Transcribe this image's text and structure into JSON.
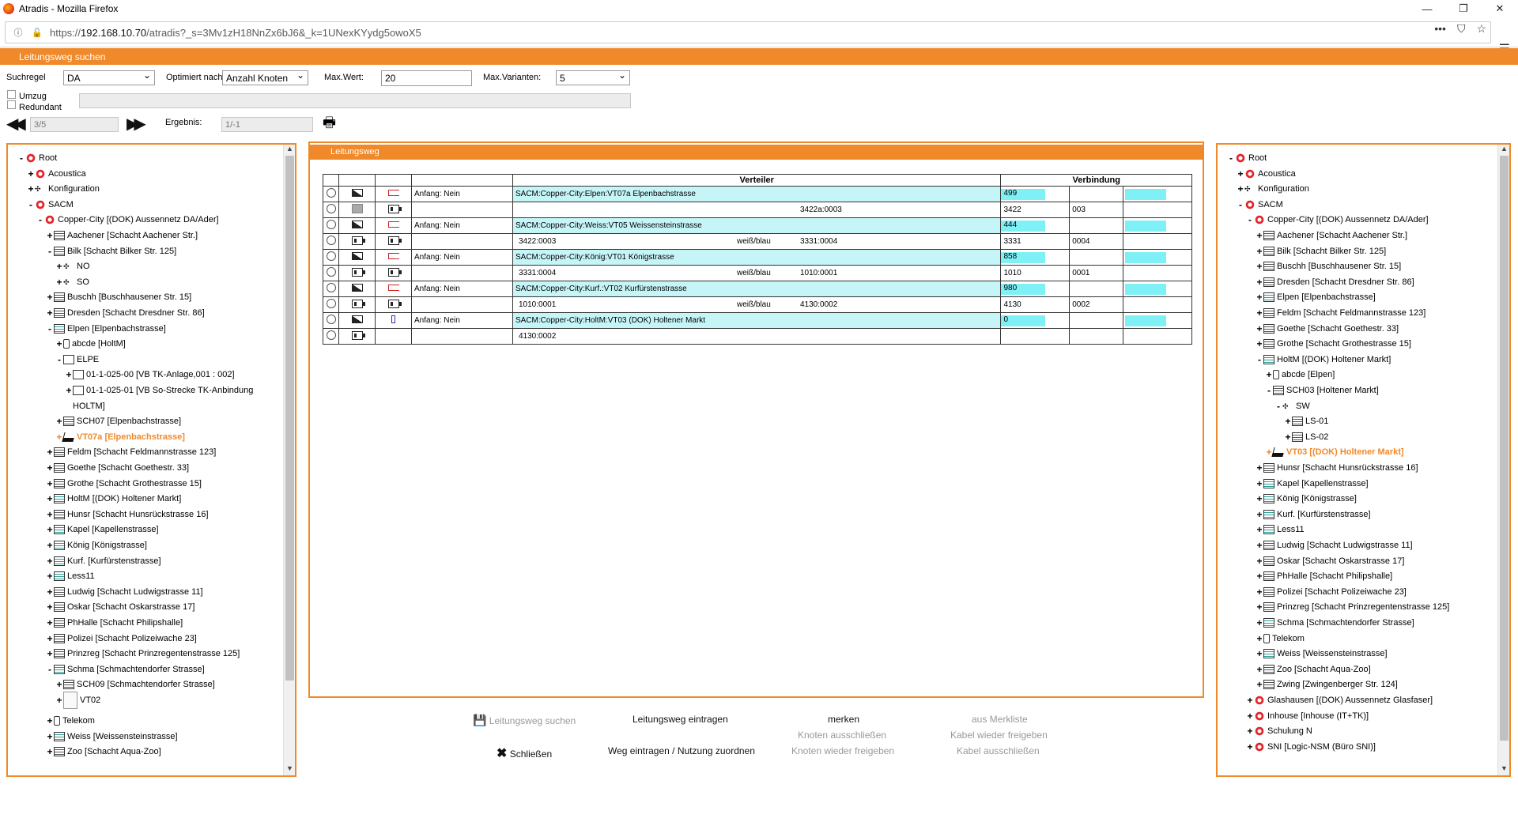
{
  "window": {
    "title": "Atradis - Mozilla Firefox"
  },
  "browser": {
    "url_prefix": "https://",
    "url_host": "192.168.10.70",
    "url_path": "/atradis?_s=3Mv1zH18NnZx6bJ6&_k=1UNexKYydg5owoX5"
  },
  "header": {
    "title": "Leitungsweg suchen"
  },
  "search": {
    "suchregel_label": "Suchregel",
    "suchregel_value": "DA",
    "optimiert_label": "Optimiert nach:",
    "optimiert_value": "Anzahl Knoten",
    "maxwert_label": "Max.Wert:",
    "maxwert_value": "20",
    "maxvar_label": "Max.Varianten:",
    "maxvar_value": "5",
    "umzug_label": "Umzug",
    "redundant_label": "Redundant",
    "page_value": "3/5",
    "ergebnis_label": "Ergebnis:",
    "ergebnis_value": "1/-1"
  },
  "left_tree": [
    {
      "t": "Root",
      "pm": "-",
      "ic": "sacm",
      "d": 0
    },
    {
      "t": "Acoustica",
      "pm": "+",
      "ic": "sacm",
      "d": 1
    },
    {
      "t": "Konfiguration",
      "pm": "+",
      "ic": "star",
      "d": 1
    },
    {
      "t": "SACM",
      "pm": "-",
      "ic": "sacm",
      "d": 1
    },
    {
      "t": "Copper-City [(DOK) Aussennetz DA/Ader]",
      "pm": "-",
      "ic": "sacm",
      "d": 2
    },
    {
      "t": "Aachener [Schacht Aachener Str.]",
      "pm": "+",
      "ic": "cab",
      "d": 3
    },
    {
      "t": "Bilk [Schacht Bilker Str. 125]",
      "pm": "-",
      "ic": "cab",
      "d": 3
    },
    {
      "t": "NO",
      "pm": "+",
      "ic": "star",
      "d": 4
    },
    {
      "t": "SO",
      "pm": "+",
      "ic": "star",
      "d": 4
    },
    {
      "t": "Buschh [Buschhausener Str. 15]",
      "pm": "+",
      "ic": "cab",
      "d": 3
    },
    {
      "t": "Dresden [Schacht Dresdner Str. 86]",
      "pm": "+",
      "ic": "cab",
      "d": 3
    },
    {
      "t": "Elpen [Elpenbachstrasse]",
      "pm": "-",
      "ic": "cabc",
      "d": 3
    },
    {
      "t": "abcde [HoltM]",
      "pm": "+",
      "ic": "phone",
      "d": 4
    },
    {
      "t": "ELPE",
      "pm": "-",
      "ic": "box",
      "d": 4
    },
    {
      "t": "01-1-025-00 [VB TK-Anlage,001 : 002]",
      "pm": "+",
      "ic": "box",
      "d": 5
    },
    {
      "t": "01-1-025-01 [VB So-Strecke TK-Anbindung",
      "pm": "+",
      "ic": "box",
      "d": 5
    },
    {
      "t": "HOLTM]",
      "pm": "",
      "ic": "",
      "d": 5
    },
    {
      "t": "SCH07 [Elpenbachstrasse]",
      "pm": "+",
      "ic": "cab",
      "d": 4
    },
    {
      "t": "VT07a [Elpenbachstrasse]",
      "pm": "+",
      "ic": "vt",
      "d": 4,
      "hl": true
    },
    {
      "t": "Feldm [Schacht Feldmannstrasse 123]",
      "pm": "+",
      "ic": "cab",
      "d": 3
    },
    {
      "t": "Goethe [Schacht Goethestr. 33]",
      "pm": "+",
      "ic": "cab",
      "d": 3
    },
    {
      "t": "Grothe [Schacht Grothestrasse 15]",
      "pm": "+",
      "ic": "cab",
      "d": 3
    },
    {
      "t": "HoltM [(DOK) Holtener Markt]",
      "pm": "+",
      "ic": "cabc",
      "d": 3
    },
    {
      "t": "Hunsr [Schacht Hunsrückstrasse 16]",
      "pm": "+",
      "ic": "cab",
      "d": 3
    },
    {
      "t": "Kapel [Kapellenstrasse]",
      "pm": "+",
      "ic": "cabc",
      "d": 3
    },
    {
      "t": "König [Königstrasse]",
      "pm": "+",
      "ic": "cabc",
      "d": 3
    },
    {
      "t": "Kurf. [Kurfürstenstrasse]",
      "pm": "+",
      "ic": "cabc",
      "d": 3
    },
    {
      "t": "Less11",
      "pm": "+",
      "ic": "cabc",
      "d": 3
    },
    {
      "t": "Ludwig [Schacht Ludwigstrasse 11]",
      "pm": "+",
      "ic": "cab",
      "d": 3
    },
    {
      "t": "Oskar [Schacht Oskarstrasse 17]",
      "pm": "+",
      "ic": "cab",
      "d": 3
    },
    {
      "t": "PhHalle [Schacht Philipshalle]",
      "pm": "+",
      "ic": "cab",
      "d": 3
    },
    {
      "t": "Polizei [Schacht Polizeiwache 23]",
      "pm": "+",
      "ic": "cab",
      "d": 3
    },
    {
      "t": "Prinzreg [Schacht Prinzregentenstrasse 125]",
      "pm": "+",
      "ic": "cab",
      "d": 3
    },
    {
      "t": "Schma [Schmachtendorfer Strasse]",
      "pm": "-",
      "ic": "cabc",
      "d": 3
    },
    {
      "t": "SCH09 [Schmachtendorfer Strasse]",
      "pm": "+",
      "ic": "cab",
      "d": 4
    },
    {
      "t": "VT02",
      "pm": "+",
      "ic": "doc",
      "d": 4
    },
    {
      "t": "Telekom",
      "pm": "+",
      "ic": "phone",
      "d": 3
    },
    {
      "t": "Weiss [Weissensteinstrasse]",
      "pm": "+",
      "ic": "cabc",
      "d": 3
    },
    {
      "t": "Zoo [Schacht Aqua-Zoo]",
      "pm": "+",
      "ic": "cab",
      "d": 3
    }
  ],
  "right_tree": [
    {
      "t": "Root",
      "pm": "-",
      "ic": "sacm",
      "d": 0
    },
    {
      "t": "Acoustica",
      "pm": "+",
      "ic": "sacm",
      "d": 1
    },
    {
      "t": "Konfiguration",
      "pm": "+",
      "ic": "star",
      "d": 1
    },
    {
      "t": "SACM",
      "pm": "-",
      "ic": "sacm",
      "d": 1
    },
    {
      "t": "Copper-City [(DOK) Aussennetz DA/Ader]",
      "pm": "-",
      "ic": "sacm",
      "d": 2
    },
    {
      "t": "Aachener [Schacht Aachener Str.]",
      "pm": "+",
      "ic": "cab",
      "d": 3
    },
    {
      "t": "Bilk [Schacht Bilker Str. 125]",
      "pm": "+",
      "ic": "cab",
      "d": 3
    },
    {
      "t": "Buschh [Buschhausener Str. 15]",
      "pm": "+",
      "ic": "cab",
      "d": 3
    },
    {
      "t": "Dresden [Schacht Dresdner Str. 86]",
      "pm": "+",
      "ic": "cab",
      "d": 3
    },
    {
      "t": "Elpen [Elpenbachstrasse]",
      "pm": "+",
      "ic": "cabc",
      "d": 3
    },
    {
      "t": "Feldm [Schacht Feldmannstrasse 123]",
      "pm": "+",
      "ic": "cab",
      "d": 3
    },
    {
      "t": "Goethe [Schacht Goethestr. 33]",
      "pm": "+",
      "ic": "cab",
      "d": 3
    },
    {
      "t": "Grothe [Schacht Grothestrasse 15]",
      "pm": "+",
      "ic": "cab",
      "d": 3
    },
    {
      "t": "HoltM [(DOK) Holtener Markt]",
      "pm": "-",
      "ic": "cabc",
      "d": 3
    },
    {
      "t": "abcde [Elpen]",
      "pm": "+",
      "ic": "phone",
      "d": 4
    },
    {
      "t": "SCH03 [Holtener Markt]",
      "pm": "-",
      "ic": "cab",
      "d": 4
    },
    {
      "t": "SW",
      "pm": "-",
      "ic": "star",
      "d": 5
    },
    {
      "t": "LS-01",
      "pm": "+",
      "ic": "cab",
      "d": 6
    },
    {
      "t": "LS-02",
      "pm": "+",
      "ic": "cab",
      "d": 6
    },
    {
      "t": "VT03 [(DOK) Holtener Markt]",
      "pm": "+",
      "ic": "vt",
      "d": 4,
      "hl": true
    },
    {
      "t": "Hunsr [Schacht Hunsrückstrasse 16]",
      "pm": "+",
      "ic": "cab",
      "d": 3
    },
    {
      "t": "Kapel [Kapellenstrasse]",
      "pm": "+",
      "ic": "cabc",
      "d": 3
    },
    {
      "t": "König [Königstrasse]",
      "pm": "+",
      "ic": "cabc",
      "d": 3
    },
    {
      "t": "Kurf. [Kurfürstenstrasse]",
      "pm": "+",
      "ic": "cabc",
      "d": 3
    },
    {
      "t": "Less11",
      "pm": "+",
      "ic": "cabc",
      "d": 3
    },
    {
      "t": "Ludwig [Schacht Ludwigstrasse 11]",
      "pm": "+",
      "ic": "cab",
      "d": 3
    },
    {
      "t": "Oskar [Schacht Oskarstrasse 17]",
      "pm": "+",
      "ic": "cab",
      "d": 3
    },
    {
      "t": "PhHalle [Schacht Philipshalle]",
      "pm": "+",
      "ic": "cab",
      "d": 3
    },
    {
      "t": "Polizei [Schacht Polizeiwache 23]",
      "pm": "+",
      "ic": "cab",
      "d": 3
    },
    {
      "t": "Prinzreg [Schacht Prinzregentenstrasse 125]",
      "pm": "+",
      "ic": "cab",
      "d": 3
    },
    {
      "t": "Schma [Schmachtendorfer Strasse]",
      "pm": "+",
      "ic": "cabc",
      "d": 3
    },
    {
      "t": "Telekom",
      "pm": "+",
      "ic": "phone",
      "d": 3
    },
    {
      "t": "Weiss [Weissensteinstrasse]",
      "pm": "+",
      "ic": "cabc",
      "d": 3
    },
    {
      "t": "Zoo [Schacht Aqua-Zoo]",
      "pm": "+",
      "ic": "cab",
      "d": 3
    },
    {
      "t": "Zwing [Zwingenberger Str. 124]",
      "pm": "+",
      "ic": "cab",
      "d": 3
    },
    {
      "t": "Glashausen [(DOK) Aussennetz Glasfaser]",
      "pm": "+",
      "ic": "sacm",
      "d": 2
    },
    {
      "t": "Inhouse [Inhouse (IT+TK)]",
      "pm": "+",
      "ic": "sacm",
      "d": 2
    },
    {
      "t": "Schulung N",
      "pm": "+",
      "ic": "sacm",
      "d": 2
    },
    {
      "t": "SNI [Logic-NSM (Büro SNI)]",
      "pm": "+",
      "ic": "sacm",
      "d": 2
    }
  ],
  "center": {
    "title": "Leitungsweg",
    "col_verteiler": "Verteiler",
    "col_verbindung": "Verbindung",
    "rows": [
      {
        "i1": "wedge",
        "i2": "red",
        "a": "Anfang: Nein",
        "v": "SACM:Copper-City:Elpen:VT07a Elpenbachstrasse",
        "v2": "",
        "v3": "",
        "c1": "499",
        "c2": "",
        "main": true
      },
      {
        "i1": "gsq",
        "i2": "sq",
        "a": "",
        "v": "",
        "v2": "",
        "v3": "3422a:0003",
        "c1": "3422",
        "c2": "003",
        "main": false
      },
      {
        "i1": "wedge",
        "i2": "red",
        "a": "Anfang: Nein",
        "v": "SACM:Copper-City:Weiss:VT05 Weissensteinstrasse",
        "v2": "",
        "v3": "",
        "c1": "444",
        "c2": "",
        "main": true
      },
      {
        "i1": "sq",
        "i2": "sq",
        "a": "",
        "v": "3422:0003",
        "v2": "weiß/blau",
        "v3": "3331:0004",
        "c1": "3331",
        "c2": "0004",
        "main": false
      },
      {
        "i1": "wedge",
        "i2": "red",
        "a": "Anfang: Nein",
        "v": "SACM:Copper-City:König:VT01 Königstrasse",
        "v2": "",
        "v3": "",
        "c1": "858",
        "c2": "",
        "main": true
      },
      {
        "i1": "sq",
        "i2": "sq",
        "a": "",
        "v": "3331:0004",
        "v2": "weiß/blau",
        "v3": "1010:0001",
        "c1": "1010",
        "c2": "0001",
        "main": false
      },
      {
        "i1": "wedge",
        "i2": "red",
        "a": "Anfang: Nein",
        "v": "SACM:Copper-City:Kurf.:VT02 Kurfürstenstrasse",
        "v2": "",
        "v3": "",
        "c1": "980",
        "c2": "",
        "main": true
      },
      {
        "i1": "sq",
        "i2": "sq",
        "a": "",
        "v": "1010:0001",
        "v2": "weiß/blau",
        "v3": "4130:0002",
        "c1": "4130",
        "c2": "0002",
        "main": false
      },
      {
        "i1": "wedge",
        "i2": "blue",
        "a": "Anfang: Nein",
        "v": "SACM:Copper-City:HoltM:VT03 (DOK) Holtener Markt",
        "v2": "",
        "v3": "",
        "c1": "0",
        "c2": "",
        "main": true
      },
      {
        "i1": "sq",
        "i2": "",
        "a": "",
        "v": "4130:0002",
        "v2": "",
        "v3": "",
        "c1": "",
        "c2": "",
        "main": false
      }
    ]
  },
  "actions": {
    "suchen": "Leitungsweg suchen",
    "eintragen": "Leitungsweg eintragen",
    "merken": "merken",
    "aus_merkliste": "aus Merkliste",
    "knoten_aus": "Knoten ausschließen",
    "kabel_frei": "Kabel wieder freigeben",
    "schliessen": "Schließen",
    "weg_eintragen": "Weg eintragen / Nutzung zuordnen",
    "knoten_frei": "Knoten wieder freigeben",
    "kabel_aus": "Kabel ausschließen"
  }
}
